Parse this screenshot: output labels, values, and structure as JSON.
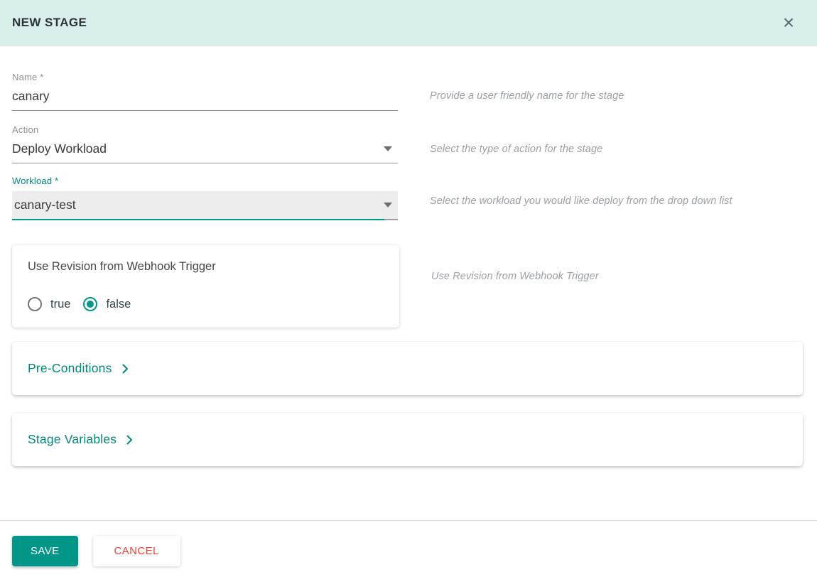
{
  "colors": {
    "header_bg": "#d9efec",
    "accent": "#009688",
    "link_teal": "#00897b",
    "cancel_red": "#f44336"
  },
  "icons": {
    "close_glyph": "×"
  },
  "header": {
    "title": "NEW STAGE"
  },
  "form": {
    "name": {
      "label": "Name *",
      "value": "canary",
      "helper": "Provide a user friendly name for the stage"
    },
    "action": {
      "label": "Action",
      "value": "Deploy Workload",
      "helper": "Select the type of action for the stage"
    },
    "workload": {
      "label": "Workload *",
      "value": "canary-test",
      "helper": "Select the workload you would like deploy from the drop down list"
    },
    "webhook": {
      "title": "Use Revision from Webhook Trigger",
      "helper": "Use Revision from Webhook Trigger",
      "options": [
        {
          "label": "true",
          "selected": false
        },
        {
          "label": "false",
          "selected": true
        }
      ]
    }
  },
  "panels": [
    {
      "label": "Pre-Conditions"
    },
    {
      "label": "Stage Variables"
    }
  ],
  "footer": {
    "save_label": "SAVE",
    "cancel_label": "CANCEL"
  }
}
